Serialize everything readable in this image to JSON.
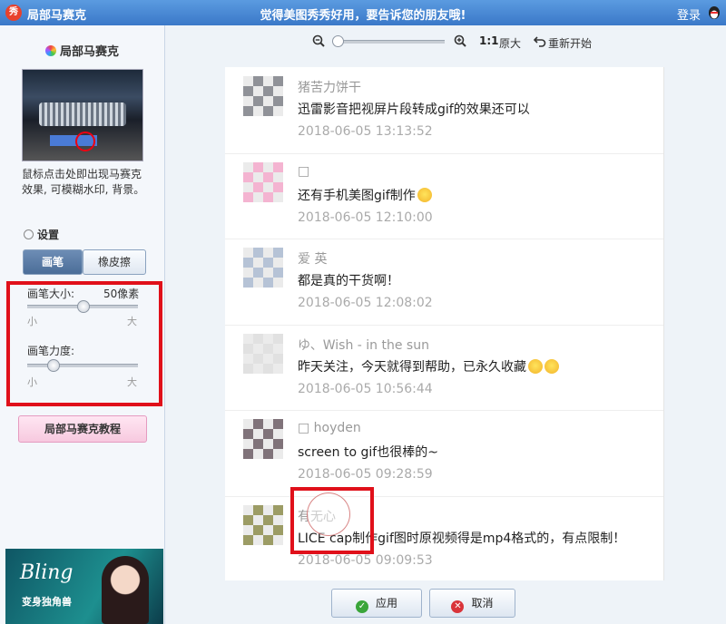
{
  "titlebar": {
    "app_title": "局部马赛克",
    "logo_text": "秀",
    "slogan": "觉得美图秀秀好用，要告诉您的朋友哦!",
    "login": "登录"
  },
  "sidebar": {
    "heading": "局部马赛克",
    "description": "鼠标点击处即出现马赛克效果, 可模糊水印, 背景。",
    "settings_label": "设置",
    "tabs": [
      {
        "label": "画笔",
        "active": true
      },
      {
        "label": "橡皮擦",
        "active": false
      }
    ],
    "brush_size": {
      "label": "画笔大小:",
      "value_text": "50像素",
      "min_label": "小",
      "max_label": "大",
      "level": 0.5
    },
    "brush_strength": {
      "label": "画笔力度:",
      "min_label": "小",
      "max_label": "大",
      "level": 0.2
    },
    "tutorial_button": "局部马赛克教程",
    "ad": {
      "title": "Bling",
      "subtitle": "变身独角兽"
    }
  },
  "toolbar": {
    "ratio": "1:1",
    "original_size": "原大",
    "reset": "重新开始",
    "zoom_level": 0.0
  },
  "comments": [
    {
      "name": "猪苦力饼干",
      "text": "迅雷影音把视屏片段转成gif的效果还可以",
      "time": "2018-06-05 13:13:52",
      "avatar_color": "#7c7f86",
      "emojis": 0
    },
    {
      "name": "□",
      "text": "还有手机美图gif制作",
      "time": "2018-06-05 12:10:00",
      "avatar_color": "#f2a7c9",
      "emojis": 1
    },
    {
      "name": "爱 英",
      "text": "都是真的干货啊！",
      "time": "2018-06-05 12:08:02",
      "avatar_color": "#a9b8cf",
      "emojis": 0
    },
    {
      "name": "ゆ、Wish - in the sun",
      "text": "昨天关注，今天就得到帮助，已永久收藏",
      "time": "2018-06-05 10:56:44",
      "avatar_color": "#dcdcdc",
      "emojis": 2
    },
    {
      "name": "□ hoyden",
      "text": "screen to gif也很棒的~",
      "time": "2018-06-05 09:28:59",
      "avatar_color": "#6a5a62",
      "emojis": 0
    },
    {
      "name": "有无心",
      "text": "LICE cap制作gif图时原视频得是mp4格式的，有点限制！",
      "time": "2018-06-05 09:09:53",
      "avatar_color": "#8a8a4a",
      "emojis": 0
    }
  ],
  "buttons": {
    "apply": "应用",
    "cancel": "取消"
  }
}
